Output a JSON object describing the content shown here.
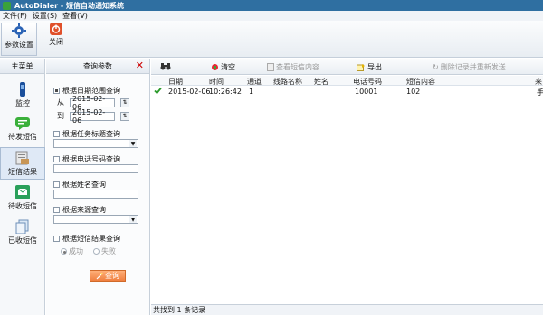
{
  "window": {
    "title": "AutoDialer - 短信自动通知系统"
  },
  "menu": {
    "items": [
      "文件(F)",
      "设置(S)",
      "查看(V)"
    ]
  },
  "toolbar": {
    "settings_label": "参数设置",
    "close_label": "关闭"
  },
  "leftnav": {
    "header": "主菜单",
    "items": [
      {
        "label": "监控",
        "icon": "monitor-icon"
      },
      {
        "label": "待发短信",
        "icon": "message-icon"
      },
      {
        "label": "短信结果",
        "icon": "sms-result-icon"
      },
      {
        "label": "待收短信",
        "icon": "inbox-icon"
      },
      {
        "label": "已收短信",
        "icon": "received-icon"
      }
    ]
  },
  "query": {
    "header": "查询参数",
    "date_range_label": "根据日期范围查询",
    "from_label": "从",
    "to_label": "到",
    "from_value": "2015-02-06",
    "to_value": "2015-02-06",
    "task_label": "根据任务标题查询",
    "phone_label": "根据电话号码查询",
    "name_label": "根据姓名查询",
    "source_label": "根据来源查询",
    "result_label": "根据短信结果查询",
    "success_label": "成功",
    "fail_label": "失败",
    "query_button": "查询"
  },
  "main": {
    "toolbar": {
      "clear": "清空",
      "view": "查看短信内容",
      "export": "导出…",
      "delete": "删除记录并重新发送"
    },
    "columns": [
      "日期",
      "时间",
      "通道",
      "线路名称",
      "姓名",
      "电话号码",
      "短信内容",
      "来"
    ],
    "rows": [
      {
        "date": "2015-02-06",
        "time": "10:26:42",
        "channel": "1",
        "line": "",
        "name": "",
        "phone": "10001",
        "content": "102",
        "source": "手"
      }
    ],
    "status": "共找到 1 条记录"
  },
  "colors": {
    "titlebar": "#2f6fa1",
    "accent": "#f08040",
    "check": "#2a9a2a"
  }
}
